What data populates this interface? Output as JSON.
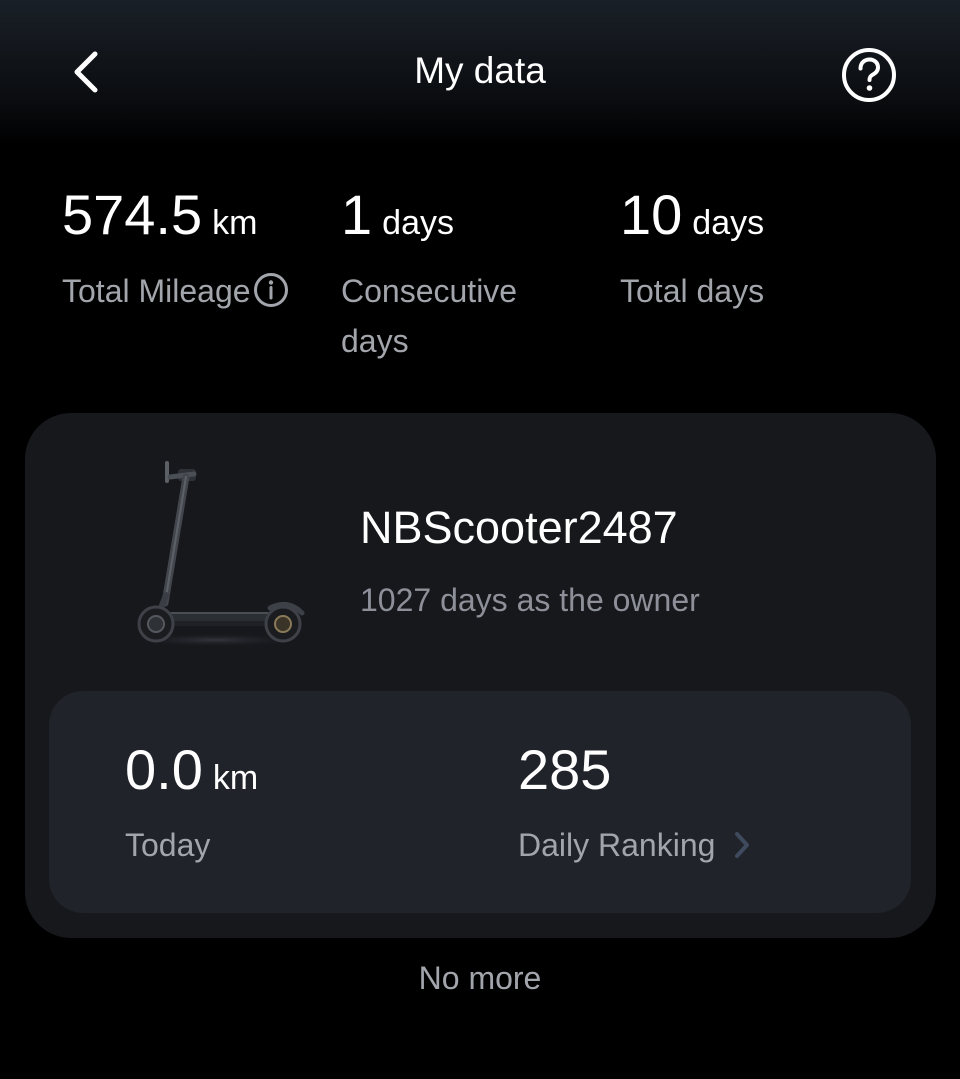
{
  "header": {
    "title": "My data"
  },
  "summary": {
    "mileage": {
      "value": "574.5",
      "unit": "km",
      "label": "Total Mileage"
    },
    "consecutive": {
      "value": "1",
      "unit": "days",
      "label": "Consecutive days"
    },
    "total_days": {
      "value": "10",
      "unit": "days",
      "label": "Total days"
    }
  },
  "scooter": {
    "name": "NBScooter2487",
    "owner_text": "1027 days as the owner",
    "today": {
      "value": "0.0",
      "unit": "km",
      "label": "Today"
    },
    "ranking": {
      "value": "285",
      "label": "Daily Ranking"
    }
  },
  "footer": {
    "no_more": "No more"
  },
  "colors": {
    "background": "#000000",
    "card": "#16181c",
    "inner_card": "#202329",
    "secondary_text": "#a2a5ab"
  },
  "icons": [
    "back-arrow-icon",
    "help-icon",
    "info-icon",
    "chevron-right-icon",
    "scooter-image"
  ]
}
